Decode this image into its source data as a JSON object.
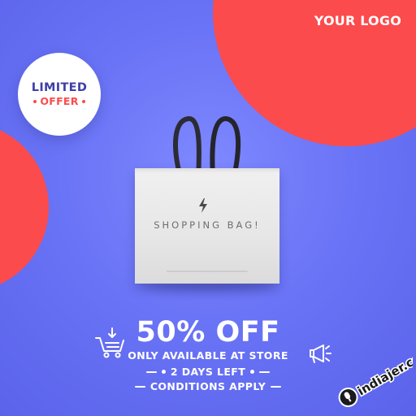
{
  "branding": {
    "logo_text": "YOUR LOGO",
    "watermark_text": "indiajer.com"
  },
  "badge": {
    "line1": "LIMITED",
    "line2": "OFFER"
  },
  "product": {
    "label": "SHOPPING BAG!"
  },
  "promo": {
    "headline": "50% OFF",
    "subline": "ONLY AVAILABLE AT STORE",
    "note1": "2 DAYS LEFT",
    "note2": "CONDITIONS APPLY"
  },
  "icons": {
    "badge_dot": "dot",
    "cart": "cart-download-icon",
    "megaphone": "megaphone-icon",
    "bolt": "lightning-bolt-icon"
  },
  "colors": {
    "background": "#6a74f6",
    "accent_red": "#fb4b4d",
    "badge_text": "#3e3fa7",
    "text_light": "#ffffff"
  }
}
